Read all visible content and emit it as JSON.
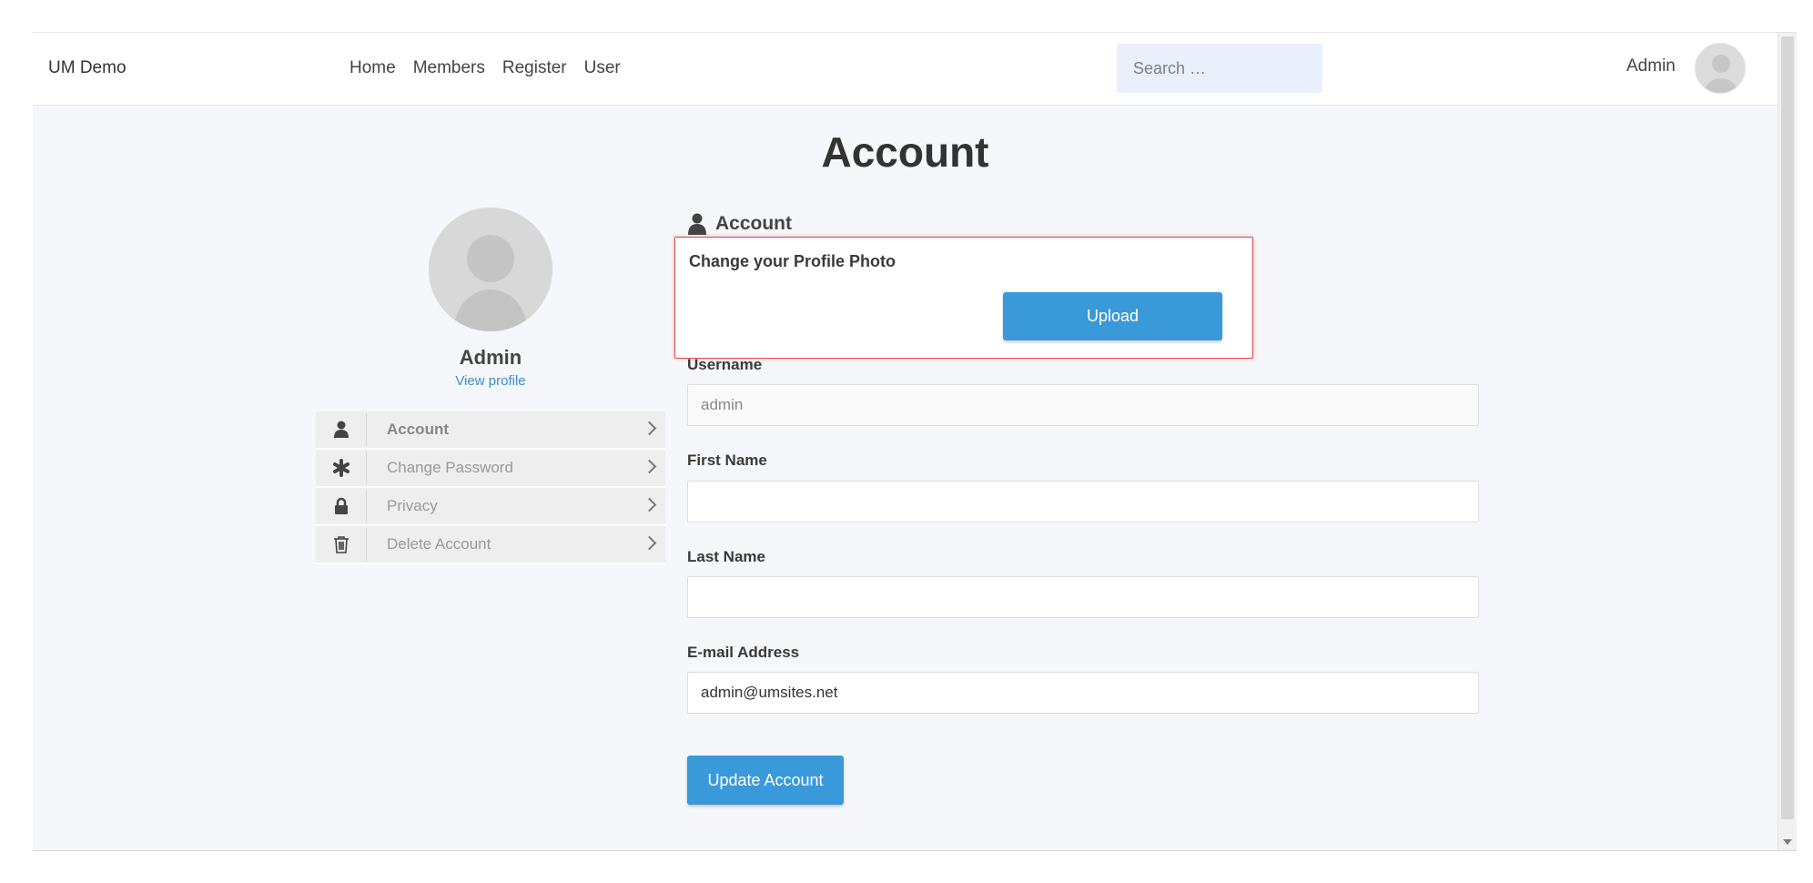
{
  "header": {
    "site_title": "UM Demo",
    "nav": [
      "Home",
      "Members",
      "Register",
      "User"
    ],
    "search_placeholder": "Search …",
    "user_name": "Admin"
  },
  "page": {
    "title": "Account"
  },
  "profile": {
    "name": "Admin",
    "view_profile": "View profile"
  },
  "sidebar": {
    "items": [
      {
        "label": "Account",
        "icon": "user-icon",
        "active": true
      },
      {
        "label": "Change Password",
        "icon": "asterisk-icon",
        "active": false
      },
      {
        "label": "Privacy",
        "icon": "lock-icon",
        "active": false
      },
      {
        "label": "Delete Account",
        "icon": "trash-icon",
        "active": false
      }
    ]
  },
  "form": {
    "section_title": "Account",
    "photo_label": "Change your Profile Photo",
    "upload_label": "Upload",
    "username_label": "Username",
    "username_value": "admin",
    "first_name_label": "First Name",
    "first_name_value": "",
    "last_name_label": "Last Name",
    "last_name_value": "",
    "email_label": "E-mail Address",
    "email_value": "admin@umsites.net",
    "submit_label": "Update Account"
  },
  "colors": {
    "accent": "#3a9ad9",
    "highlight_border": "#e04646",
    "link": "#3a8dd0"
  }
}
